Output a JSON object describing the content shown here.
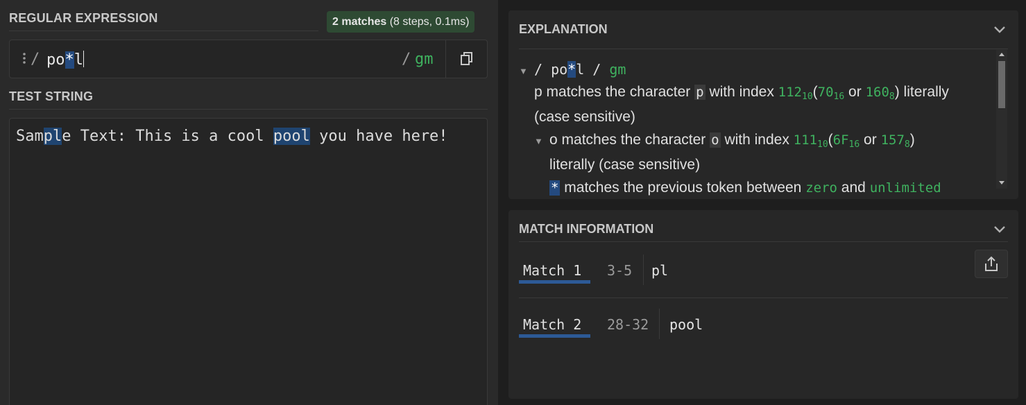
{
  "regex_section": {
    "title": "REGULAR EXPRESSION",
    "badge_bold": "2 matches",
    "badge_detail": "(8 steps, 0.1ms)",
    "open_delim": "/",
    "pattern_before": "po",
    "pattern_star": "*",
    "pattern_after": "l",
    "close_delim": "/",
    "flags": "gm"
  },
  "test_section": {
    "title": "TEST STRING",
    "seg1": "Sam",
    "match1": "pl",
    "seg2": "e Text: This is a cool ",
    "match2": "pool",
    "seg3": " you have here!"
  },
  "explanation": {
    "title": "EXPLANATION",
    "line1_pattern_pre": "/ po",
    "line1_star": "*",
    "line1_pattern_post": "l / ",
    "line1_flags": "gm",
    "p_token": "p",
    "p_text1": "matches the character",
    "p_chip": "p",
    "p_text2": "with index",
    "p_dec": "112",
    "p_dec_base": "10",
    "p_paren_open": "(",
    "p_hex": "70",
    "p_hex_base": "16",
    "p_or": "or",
    "p_oct": "160",
    "p_oct_base": "8",
    "p_text3": ") literally",
    "p_case": "(case sensitive)",
    "o_token": "o",
    "o_text1": "matches the character",
    "o_chip": "o",
    "o_text2": "with index",
    "o_dec": "111",
    "o_dec_base": "10",
    "o_paren_open": "(",
    "o_hex": "6F",
    "o_hex_base": "16",
    "o_or": "or",
    "o_oct": "157",
    "o_oct_base": "8",
    "o_paren_close": ")",
    "o_case": "literally (case sensitive)",
    "star_chip": "*",
    "star_text1": "matches the previous token between",
    "star_zero": "zero",
    "star_and": "and",
    "star_unlimited": "unlimited"
  },
  "match_info": {
    "title": "MATCH INFORMATION",
    "matches": [
      {
        "label": "Match 1",
        "range": "3-5",
        "value": "pl"
      },
      {
        "label": "Match 2",
        "range": "28-32",
        "value": "pool"
      }
    ]
  },
  "colors": {
    "accent_green": "#3fb25f",
    "highlight_blue": "#244a7f",
    "match_blue": "#1f4470",
    "badge_green": "#2e4a33"
  }
}
